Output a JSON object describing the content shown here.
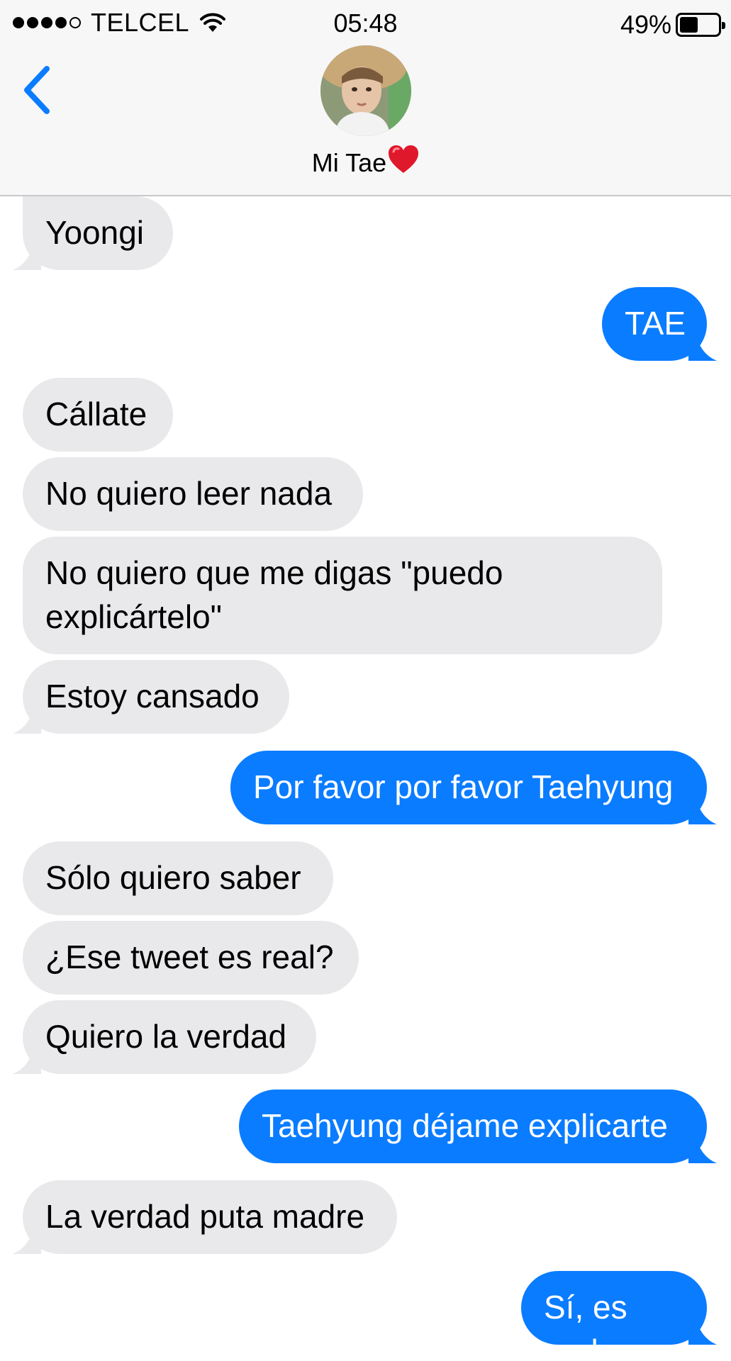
{
  "status_bar": {
    "carrier": "TELCEL",
    "time": "05:48",
    "battery_percent": "49%",
    "battery_level": 0.49,
    "signal_bars": 4,
    "signal_max": 5
  },
  "header": {
    "contact_name": "Mi Tae",
    "back_icon": "chevron-left-icon",
    "heart_icon": "red-heart-icon"
  },
  "colors": {
    "sent_bubble": "#0a7cff",
    "received_bubble": "#e9e9eb",
    "accent": "#0a7cff"
  },
  "messages": [
    {
      "direction": "received",
      "text": "Yoongi"
    },
    {
      "direction": "sent",
      "text": "TAE"
    },
    {
      "direction": "received",
      "text": "Cállate"
    },
    {
      "direction": "received",
      "text": "No quiero leer nada"
    },
    {
      "direction": "received",
      "text": "No quiero que me digas \"puedo explicártelo\""
    },
    {
      "direction": "received",
      "text": "Estoy cansado"
    },
    {
      "direction": "sent",
      "text": "Por favor por favor Taehyung"
    },
    {
      "direction": "received",
      "text": "Sólo quiero saber"
    },
    {
      "direction": "received",
      "text": "¿Ese tweet es real?"
    },
    {
      "direction": "received",
      "text": "Quiero la verdad"
    },
    {
      "direction": "sent",
      "text": "Taehyung déjame explicarte"
    },
    {
      "direction": "received",
      "text": "La verdad puta madre"
    },
    {
      "direction": "sent",
      "text": "Sí, es real"
    }
  ]
}
